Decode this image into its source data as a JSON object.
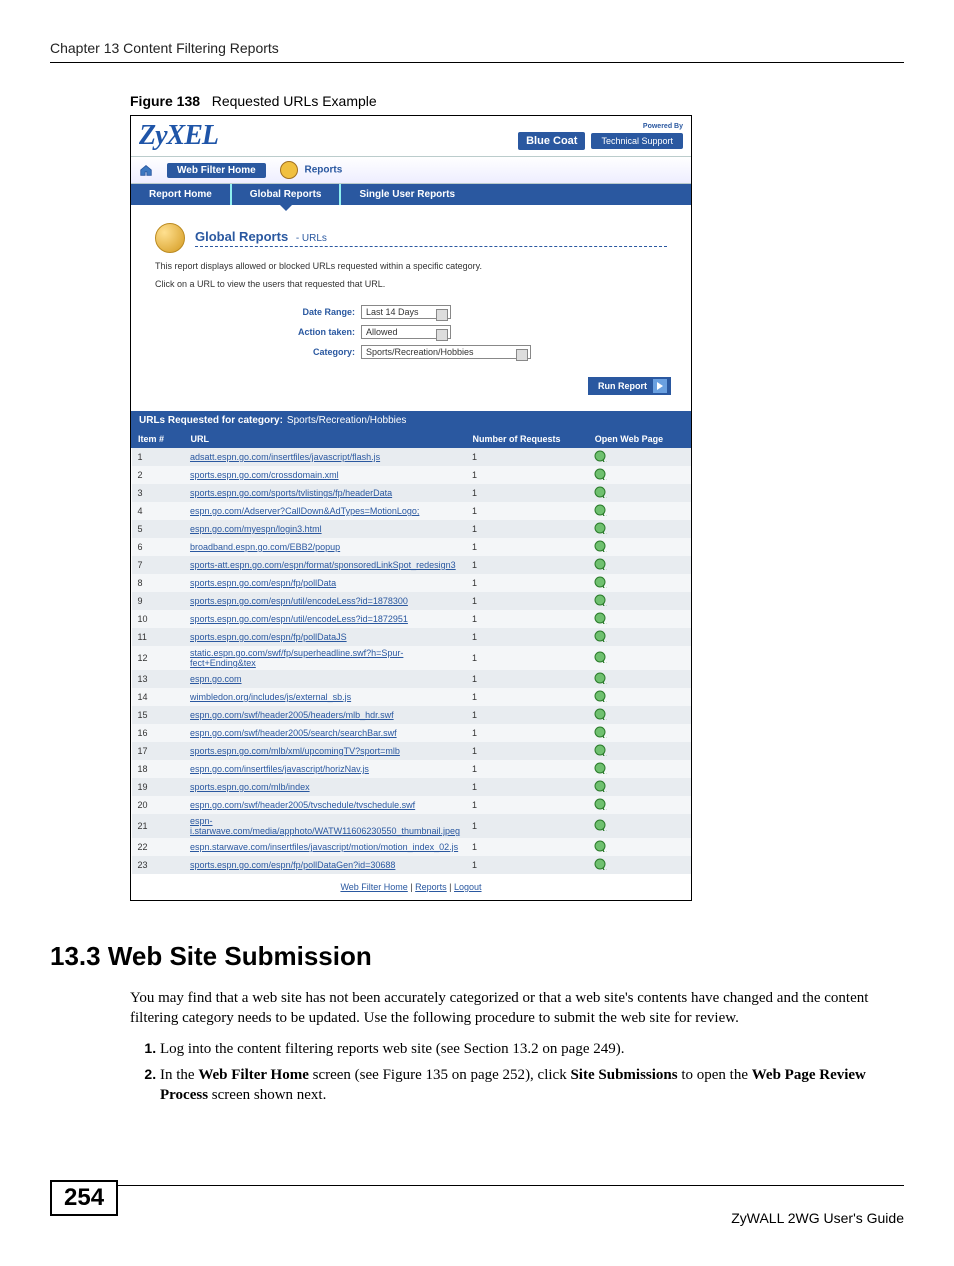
{
  "chapter_header": "Chapter 13 Content Filtering Reports",
  "figure_caption_bold": "Figure 138",
  "figure_caption_text": "Requested URLs Example",
  "screenshot": {
    "logo": "ZyXEL",
    "powered_by": "Powered By",
    "bluecoat": "Blue Coat",
    "tech_support": "Technical Support",
    "nav1": {
      "home": "Web Filter Home",
      "reports": "Reports"
    },
    "nav2": {
      "report_home": "Report Home",
      "global_reports": "Global Reports",
      "single_user": "Single User Reports"
    },
    "panel_title": "Global Reports",
    "panel_subtitle": "- URLs",
    "desc1": "This report displays allowed or blocked URLs requested within a specific category.",
    "desc2": "Click on a URL to view the users that requested that URL.",
    "filters": {
      "date_range_label": "Date Range:",
      "date_range_value": "Last 14 Days",
      "action_label": "Action taken:",
      "action_value": "Allowed",
      "category_label": "Category:",
      "category_value": "Sports/Recreation/Hobbies"
    },
    "run_report": "Run Report",
    "cat_bar_prefix": "URLs Requested for category:",
    "cat_bar_value": "Sports/Recreation/Hobbies",
    "table_headers": {
      "item": "Item #",
      "url": "URL",
      "requests": "Number of Requests",
      "open": "Open Web Page"
    },
    "rows": [
      {
        "n": "1",
        "url": "adsatt.espn.go.com/insertfiles/javascript/flash.js",
        "req": "1"
      },
      {
        "n": "2",
        "url": "sports.espn.go.com/crossdomain.xml",
        "req": "1"
      },
      {
        "n": "3",
        "url": "sports.espn.go.com/sports/tvlistings/fp/headerData",
        "req": "1"
      },
      {
        "n": "4",
        "url": "espn.go.com/Adserver?CallDown&AdTypes=MotionLogo;",
        "req": "1"
      },
      {
        "n": "5",
        "url": "espn.go.com/myespn/login3.html",
        "req": "1"
      },
      {
        "n": "6",
        "url": "broadband.espn.go.com/EBB2/popup",
        "req": "1"
      },
      {
        "n": "7",
        "url": "sports-att.espn.go.com/espn/format/sponsoredLinkSpot_redesign3",
        "req": "1"
      },
      {
        "n": "8",
        "url": "sports.espn.go.com/espn/fp/pollData",
        "req": "1"
      },
      {
        "n": "9",
        "url": "sports.espn.go.com/espn/util/encodeLess?id=1878300",
        "req": "1"
      },
      {
        "n": "10",
        "url": "sports.espn.go.com/espn/util/encodeLess?id=1872951",
        "req": "1"
      },
      {
        "n": "11",
        "url": "sports.espn.go.com/espn/fp/pollDataJS",
        "req": "1"
      },
      {
        "n": "12",
        "url": "static.espn.go.com/swf/fp/superheadline.swf?h=Spur-fect+Ending&tex",
        "req": "1"
      },
      {
        "n": "13",
        "url": "espn.go.com",
        "req": "1"
      },
      {
        "n": "14",
        "url": "wimbledon.org/includes/js/external_sb.js",
        "req": "1"
      },
      {
        "n": "15",
        "url": "espn.go.com/swf/header2005/headers/mlb_hdr.swf",
        "req": "1"
      },
      {
        "n": "16",
        "url": "espn.go.com/swf/header2005/search/searchBar.swf",
        "req": "1"
      },
      {
        "n": "17",
        "url": "sports.espn.go.com/mlb/xml/upcomingTV?sport=mlb",
        "req": "1"
      },
      {
        "n": "18",
        "url": "espn.go.com/insertfiles/javascript/horizNav.js",
        "req": "1"
      },
      {
        "n": "19",
        "url": "sports.espn.go.com/mlb/index",
        "req": "1"
      },
      {
        "n": "20",
        "url": "espn.go.com/swf/header2005/tvschedule/tvschedule.swf",
        "req": "1"
      },
      {
        "n": "21",
        "url": "espn-i.starwave.com/media/apphoto/WATW11606230550_thumbnail.jpeg",
        "req": "1"
      },
      {
        "n": "22",
        "url": "espn.starwave.com/insertfiles/javascript/motion/motion_index_02.js",
        "req": "1"
      },
      {
        "n": "23",
        "url": "sports.espn.go.com/espn/fp/pollDataGen?id=30688",
        "req": "1"
      }
    ],
    "footer": {
      "home": "Web Filter Home",
      "reports": "Reports",
      "logout": "Logout"
    }
  },
  "section_heading": "13.3  Web Site Submission",
  "section_intro": "You may find that a web site has not been accurately categorized or that a web site's contents have changed and the content filtering category needs to be updated. Use the following procedure to submit the web site for review.",
  "step1_a": "Log into the content filtering reports web site (see ",
  "step1_link": "Section 13.2 on page 249",
  "step1_b": ").",
  "step2_a": "In the ",
  "step2_bold1": "Web Filter Home",
  "step2_b": " screen (see ",
  "step2_link": "Figure 135 on page 252",
  "step2_c": "), click ",
  "step2_bold2": "Site Submissions",
  "step2_d": " to open the ",
  "step2_bold3": "Web Page Review Process",
  "step2_e": " screen shown next.",
  "page_number": "254",
  "guide_name": "ZyWALL 2WG User's Guide"
}
